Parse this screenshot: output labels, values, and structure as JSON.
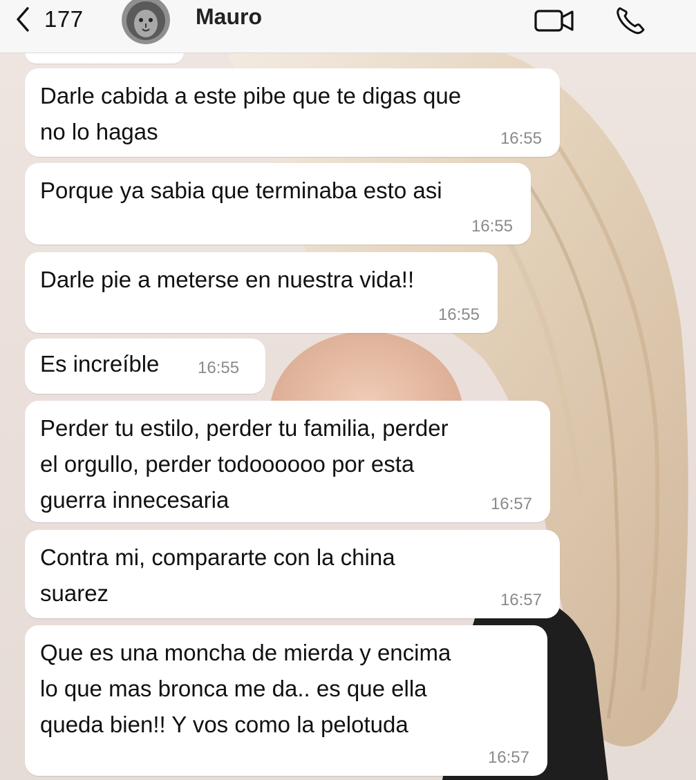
{
  "header": {
    "back_count": "177",
    "contact_name": "Mauro",
    "back_icon": "chevron-left-icon",
    "video_icon": "video-camera-icon",
    "call_icon": "phone-icon",
    "avatar_icon": "lion-avatar"
  },
  "messages": [
    {
      "text": "Darle cabida a este pibe que te digas que\nno lo hagas",
      "time": "16:55"
    },
    {
      "text": "Porque ya sabia que terminaba esto asi",
      "time": "16:55"
    },
    {
      "text": "Darle pie a meterse en nuestra vida!!",
      "time": "16:55"
    },
    {
      "text": "Es increíble",
      "time": "16:55"
    },
    {
      "text": "Perder tu estilo, perder tu familia, perder\nel orgullo, perder todoooooo por esta\nguerra innecesaria",
      "time": "16:57"
    },
    {
      "text": "Contra mi, compararte con la china\nsuarez",
      "time": "16:57"
    },
    {
      "text": "Que es una moncha de mierda y encima\nlo que mas bronca me da.. es que ella\nqueda bien!! Y vos como la pelotuda",
      "time": "16:57"
    }
  ],
  "colors": {
    "bubble_incoming": "#ffffff",
    "header_background": "#f7f7f7",
    "timestamp": "#8a8a8a"
  }
}
